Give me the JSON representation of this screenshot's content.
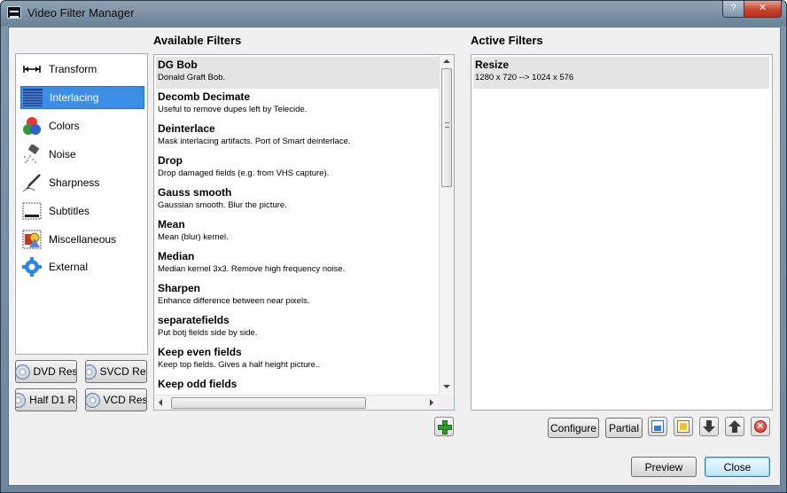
{
  "window": {
    "title": "Video Filter Manager",
    "help_glyph": "?",
    "close_glyph": "✕"
  },
  "available": {
    "heading": "Available Filters",
    "filters": [
      {
        "name": "DG Bob",
        "desc": "Donald Graft Bob."
      },
      {
        "name": "Decomb Decimate",
        "desc": "Useful to remove dupes left by Telecide."
      },
      {
        "name": "Deinterlace",
        "desc": "Mask interlacing artifacts. Port of Smart deinterlace."
      },
      {
        "name": "Drop",
        "desc": "Drop damaged fields (e.g. from VHS capture)."
      },
      {
        "name": "Gauss smooth",
        "desc": "Gaussian smooth. Blur the picture."
      },
      {
        "name": "Mean",
        "desc": "Mean (blur) kernel."
      },
      {
        "name": "Median",
        "desc": "Median kernel 3x3. Remove high frequency noise."
      },
      {
        "name": "Sharpen",
        "desc": "Enhance difference between near pixels."
      },
      {
        "name": "separatefields",
        "desc": "Put botj fields side by side."
      },
      {
        "name": "Keep even fields",
        "desc": "Keep top fields. Gives a half height picture.."
      },
      {
        "name": "Keep odd fields",
        "desc": ""
      }
    ]
  },
  "active": {
    "heading": "Active Filters",
    "filters": [
      {
        "name": "Resize",
        "desc": "1280 x 720 --> 1024 x 576"
      }
    ]
  },
  "categories": [
    {
      "label": "Transform",
      "icon": "transform-icon"
    },
    {
      "label": "Interlacing",
      "icon": "interlacing-icon"
    },
    {
      "label": "Colors",
      "icon": "colors-icon"
    },
    {
      "label": "Noise",
      "icon": "noise-icon"
    },
    {
      "label": "Sharpness",
      "icon": "sharpness-icon"
    },
    {
      "label": "Subtitles",
      "icon": "subtitles-icon"
    },
    {
      "label": "Miscellaneous",
      "icon": "miscellaneous-icon"
    },
    {
      "label": "External",
      "icon": "external-icon"
    }
  ],
  "selected_category": "Interlacing",
  "res_buttons": {
    "dvd": "DVD Res",
    "svcd": "SVCD Res",
    "half_d1": "Half D1 Re",
    "vcd": "VCD Res"
  },
  "buttons": {
    "configure": "Configure",
    "partial": "Partial",
    "preview": "Preview",
    "close": "Close"
  },
  "colors": {
    "selection": "#3d8ee6",
    "add_green": "#2f9a2f",
    "remove_red": "#d0281a"
  }
}
